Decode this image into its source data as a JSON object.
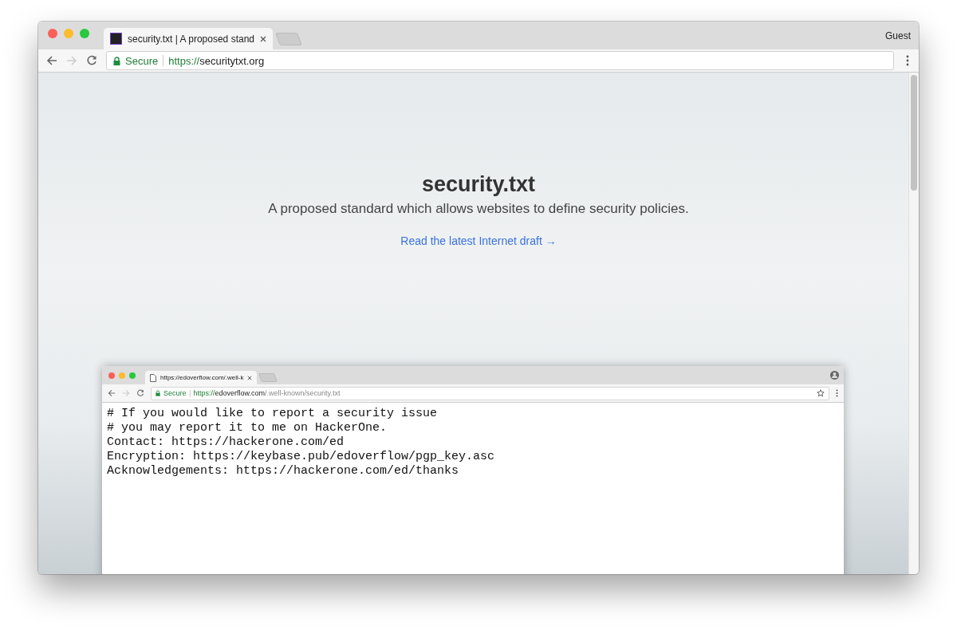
{
  "browser": {
    "tab": {
      "title": "security.txt | A proposed stand"
    },
    "profile": "Guest",
    "security": "Secure",
    "url": {
      "scheme": "https://",
      "host": "securitytxt.org"
    }
  },
  "page": {
    "title": "security.txt",
    "subtitle": "A proposed standard which allows websites to define security policies.",
    "link": "Read the latest Internet draft →"
  },
  "inner_browser": {
    "tab": {
      "title": "https://edoverflow.com/.well-k"
    },
    "security": "Secure",
    "url": {
      "scheme": "https://",
      "host": "edoverflow.com",
      "path": "/.well-known/security.txt"
    },
    "lines": [
      "# If you would like to report a security issue",
      "# you may report it to me on HackerOne.",
      "Contact: https://hackerone.com/ed",
      "Encryption: https://keybase.pub/edoverflow/pgp_key.asc",
      "Acknowledgements: https://hackerone.com/ed/thanks"
    ]
  }
}
